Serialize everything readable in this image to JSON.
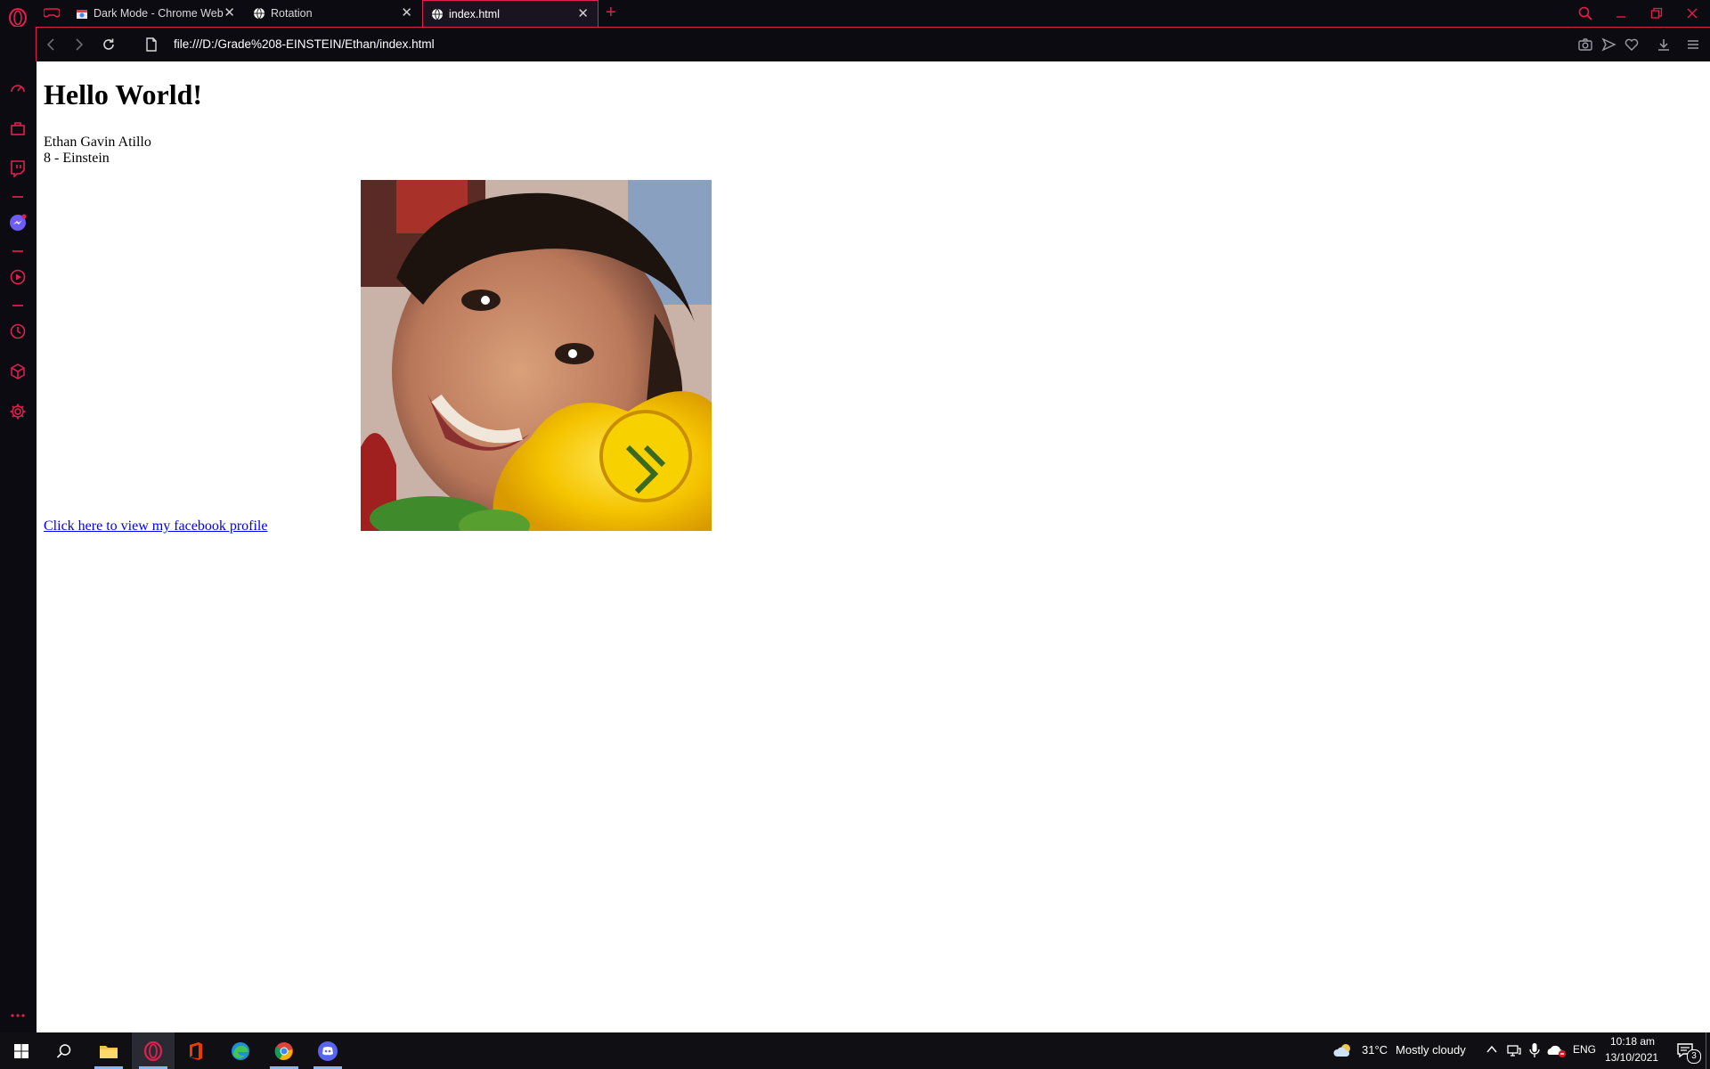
{
  "tabs": [
    {
      "title": "Dark Mode - Chrome Web Store",
      "favicon": "web-store-icon"
    },
    {
      "title": "Rotation",
      "favicon": "globe-icon"
    },
    {
      "title": "index.html",
      "favicon": "globe-icon",
      "active": true
    }
  ],
  "address_bar": {
    "url": "file:///D:/Grade%208-EINSTEIN/Ethan/index.html"
  },
  "page": {
    "heading": "Hello World!",
    "name": "Ethan Gavin Atillo",
    "section": "8 - Einstein",
    "link_text": "Click here to view my facebook profile"
  },
  "taskbar": {
    "weather_temp": "31°C",
    "weather_desc": "Mostly cloudy",
    "language": "ENG",
    "time": "10:18 am",
    "date": "13/10/2021",
    "notification_count": "3"
  },
  "colors": {
    "accent": "#e0204f",
    "chrome_bg": "#0d0b12",
    "link": "#0000ee"
  }
}
